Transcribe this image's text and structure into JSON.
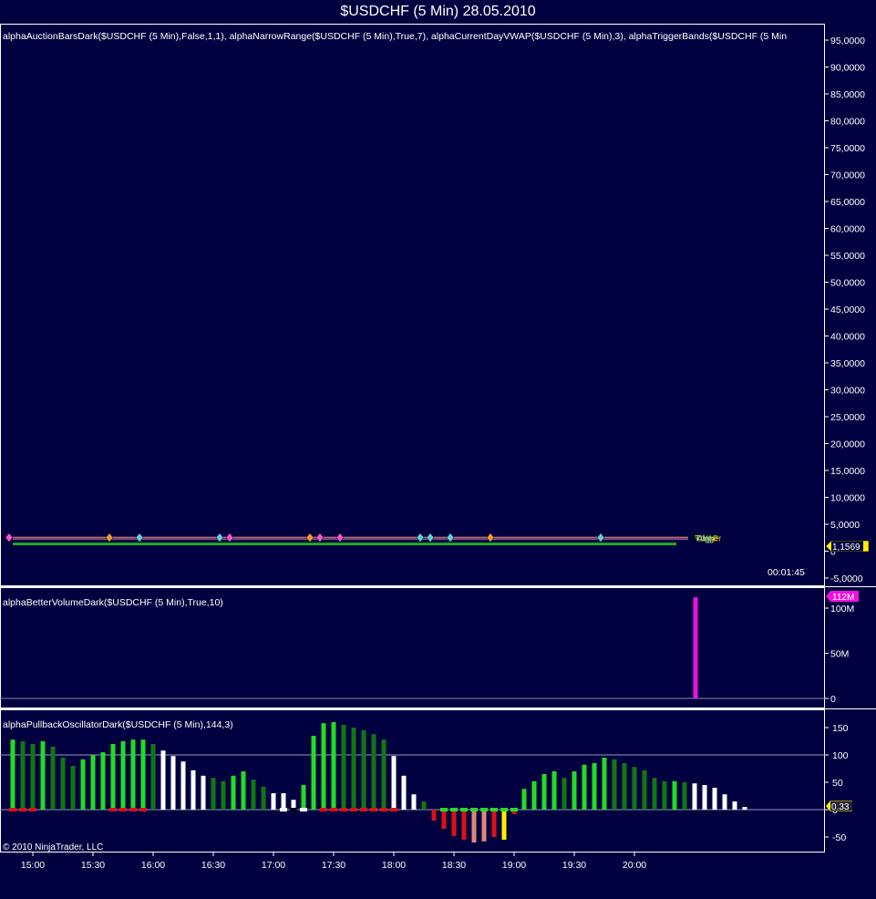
{
  "title": "$USDCHF (5 Min)  28.05.2010",
  "price_panel": {
    "label": "alphaAuctionBarsDark($USDCHF  (5  Min),False,1,1),  alphaNarrowRange($USDCHF  (5  Min),True,7),  alphaCurrentDayVWAP($USDCHF  (5  Min),3),  alphaTriggerBands($USDCHF  (5  Min",
    "y_ticks": [
      "95,0000",
      "90,0000",
      "85,0000",
      "80,0000",
      "75,0000",
      "70,0000",
      "65,0000",
      "60,0000",
      "55,0000",
      "50,0000",
      "45,0000",
      "40,0000",
      "35,0000",
      "30,0000",
      "25,0000",
      "20,0000",
      "15,0000",
      "10,0000",
      "5,0000",
      "0",
      "-5,0000"
    ],
    "last_price": "1,1569",
    "timer": "00:01:45"
  },
  "volume_panel": {
    "label": "alphaBetterVolumeDark($USDCHF (5 Min),True,10)",
    "y_ticks": [
      "100M",
      "50M",
      "0"
    ],
    "last_value": "112M"
  },
  "oscillator_panel": {
    "label": "alphaPullbackOscillatorDark($USDCHF (5 Min),144,3)",
    "y_ticks": [
      "150",
      "100",
      "50",
      "0",
      "-50"
    ],
    "last_value": "0.33"
  },
  "copyright": "© 2010 NinjaTrader, LLC",
  "x_ticks": [
    "15:00",
    "15:30",
    "16:00",
    "16:30",
    "17:00",
    "17:30",
    "18:00",
    "18:30",
    "19:00",
    "19:30",
    "20:00"
  ],
  "colors": {
    "background": "#000040",
    "bright_green": "#22dd22",
    "dark_green": "#117711",
    "white": "#ffffff",
    "red": "#dd1111",
    "salmon": "#dd8877",
    "yellow": "#ffee00",
    "magenta": "#ee11dd",
    "ma_line": "#bb6666",
    "vwap_line": "#22aa22"
  },
  "chart_data": [
    {
      "type": "line",
      "title": "$USDCHF (5 Min)  28.05.2010",
      "ylim": [
        -5,
        95
      ],
      "unit_note": "",
      "last_price": 1.1569,
      "series": [
        {
          "name": "",
          "value_approx": 1.16
        }
      ],
      "markers_x_times": [
        "14:50",
        "15:40",
        "15:55",
        "16:35",
        "16:40",
        "17:20",
        "17:25",
        "17:35",
        "18:15",
        "18:20",
        "18:30",
        "18:50",
        "19:45"
      ]
    },
    {
      "type": "bar",
      "title": "alphaBetterVolumeDark($USDCHF (5 Min),True,10)",
      "ylim": [
        0,
        112
      ],
      "categories": [
        "20:25"
      ],
      "values": [
        112
      ]
    },
    {
      "type": "bar",
      "title": "alphaPullbackOscillatorDark($USDCHF (5 Min),144,3)",
      "ylim": [
        -60,
        160
      ],
      "x_start": "14:50",
      "step_minutes": 5,
      "values": [
        128,
        125,
        120,
        125,
        115,
        95,
        80,
        92,
        100,
        105,
        120,
        125,
        128,
        128,
        120,
        108,
        98,
        88,
        72,
        62,
        58,
        52,
        62,
        70,
        55,
        42,
        30,
        30,
        18,
        45,
        135,
        158,
        160,
        155,
        150,
        145,
        138,
        128,
        98,
        62,
        28,
        15,
        -20,
        -35,
        -48,
        -55,
        -60,
        -58,
        -50,
        -55,
        -8,
        38,
        52,
        65,
        70,
        58,
        70,
        82,
        85,
        95,
        92,
        85,
        78,
        72,
        58,
        52,
        52,
        50,
        48,
        45,
        40,
        28,
        15,
        5
      ],
      "markers": "dots at zero line: red (bearish), green (bullish), white (neutral)",
      "last_value": 0.33
    }
  ]
}
